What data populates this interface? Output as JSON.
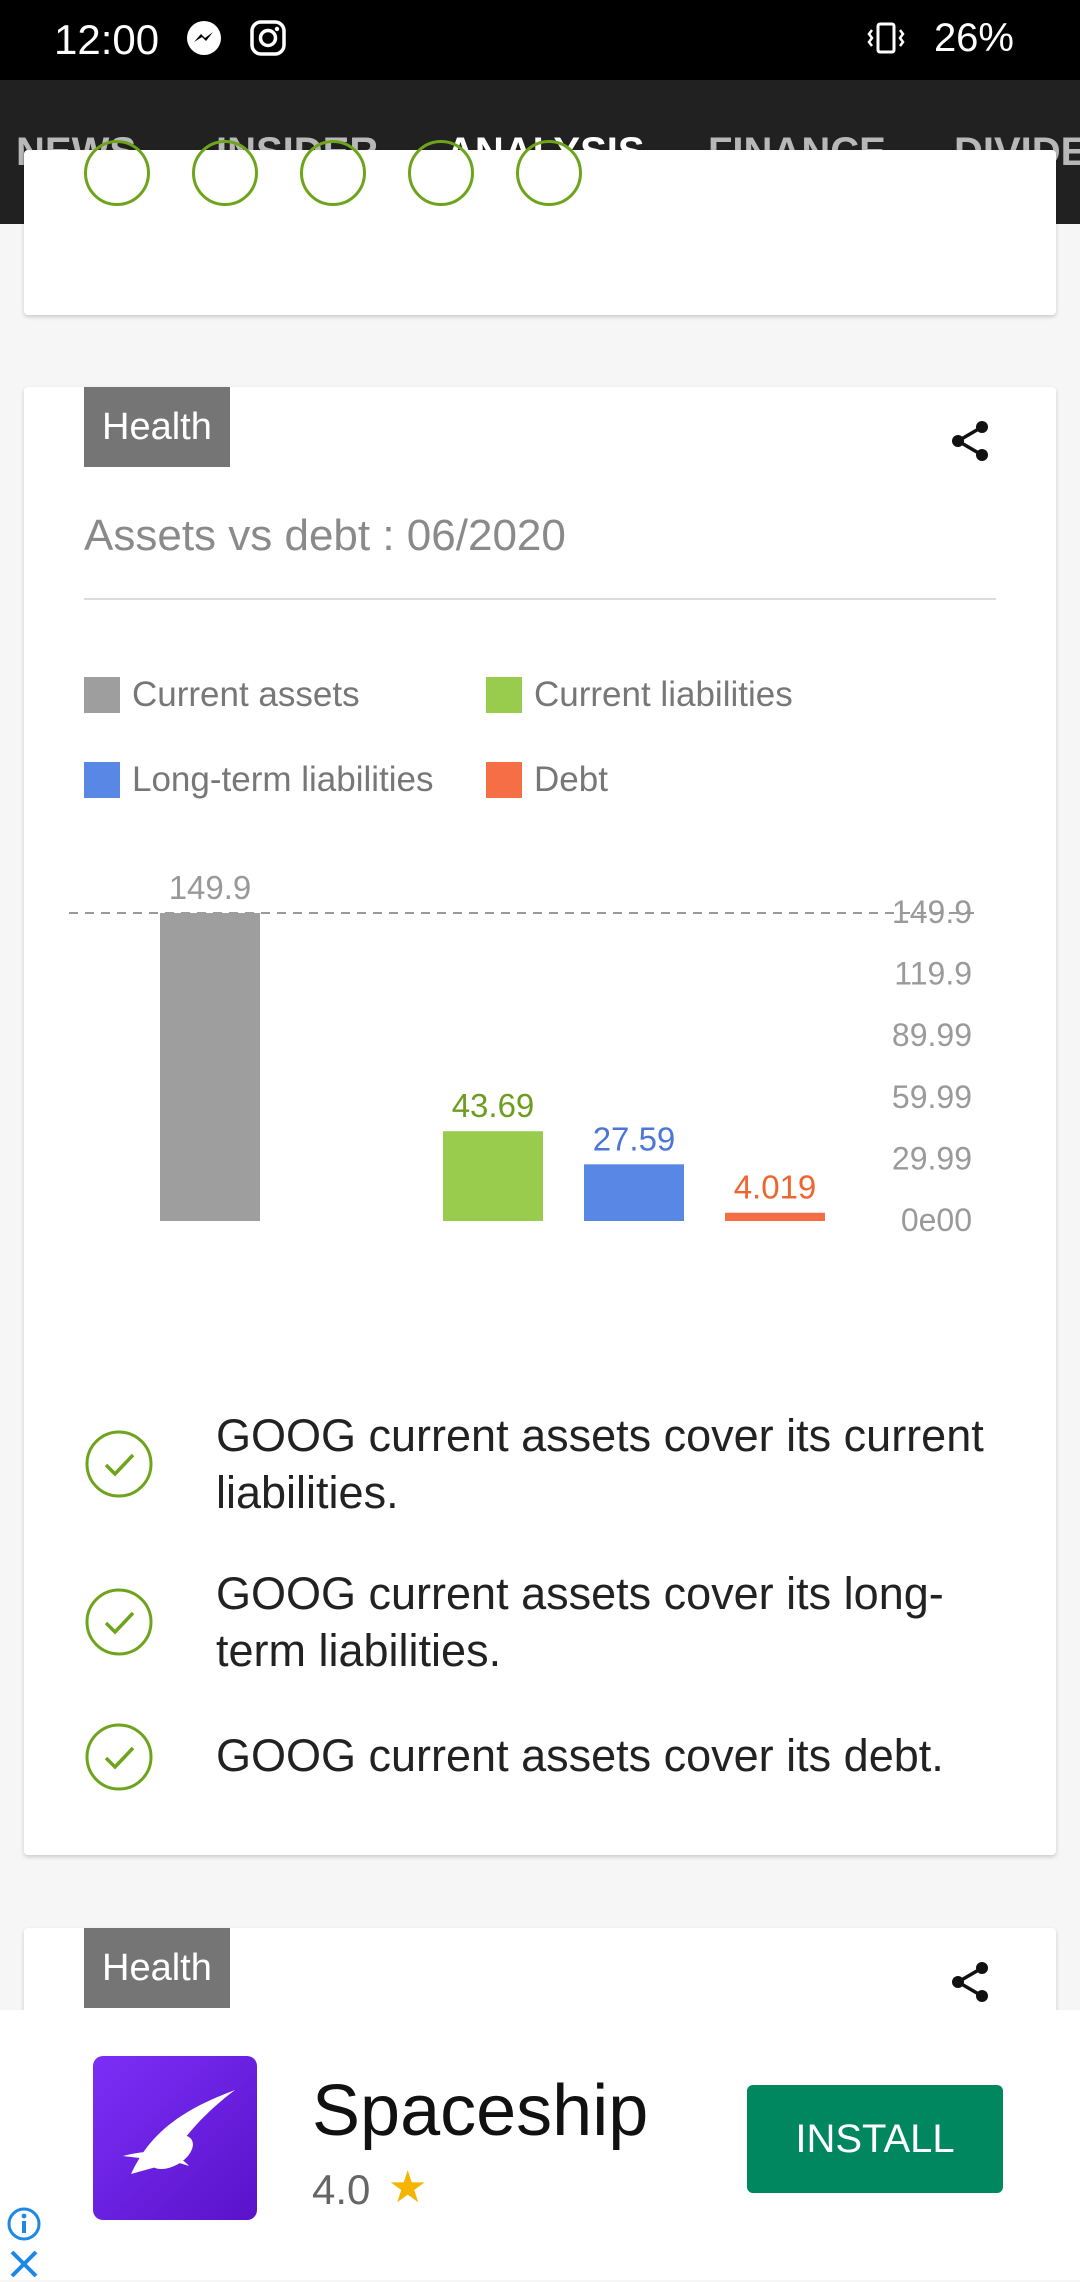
{
  "status_bar": {
    "time": "12:00",
    "battery": "26%"
  },
  "tabs": [
    {
      "label": "NEWS",
      "active": false
    },
    {
      "label": "INSIDER",
      "active": false
    },
    {
      "label": "ANALYSIS",
      "active": true
    },
    {
      "label": "FINANCE",
      "active": false
    },
    {
      "label": "DIVIDE",
      "active": false
    }
  ],
  "main_card": {
    "badge": "Health",
    "title": "Assets vs debt : 06/2020",
    "checks": [
      {
        "text": "GOOG current assets cover its current liabilities."
      },
      {
        "text": "GOOG current assets cover its long-term liabilities."
      },
      {
        "text": "GOOG current assets cover its debt."
      }
    ]
  },
  "next_card": {
    "badge": "Health"
  },
  "chart_data": {
    "type": "bar",
    "categories": [
      "Current assets",
      "Current liabilities",
      "Long-term liabilities",
      "Debt"
    ],
    "values": [
      149.9,
      43.69,
      27.59,
      4.019
    ],
    "value_labels": [
      "149.9",
      "43.69",
      "27.59",
      "4.019"
    ],
    "colors": [
      "#9e9e9e",
      "#99cc4d",
      "#5987e6",
      "#f56e45"
    ],
    "label_colors": [
      "#999999",
      "#6b9e1f",
      "#4b76d8",
      "#f0642e"
    ],
    "y_ticks": [
      "149.9",
      "119.9",
      "89.99",
      "59.99",
      "29.99",
      "0e00"
    ],
    "ylim": [
      0,
      149.9
    ],
    "reference_line": 149.9,
    "legend": "top"
  },
  "ad": {
    "app_name": "Spaceship",
    "rating": "4.0",
    "star": "★",
    "install_label": "INSTALL"
  }
}
